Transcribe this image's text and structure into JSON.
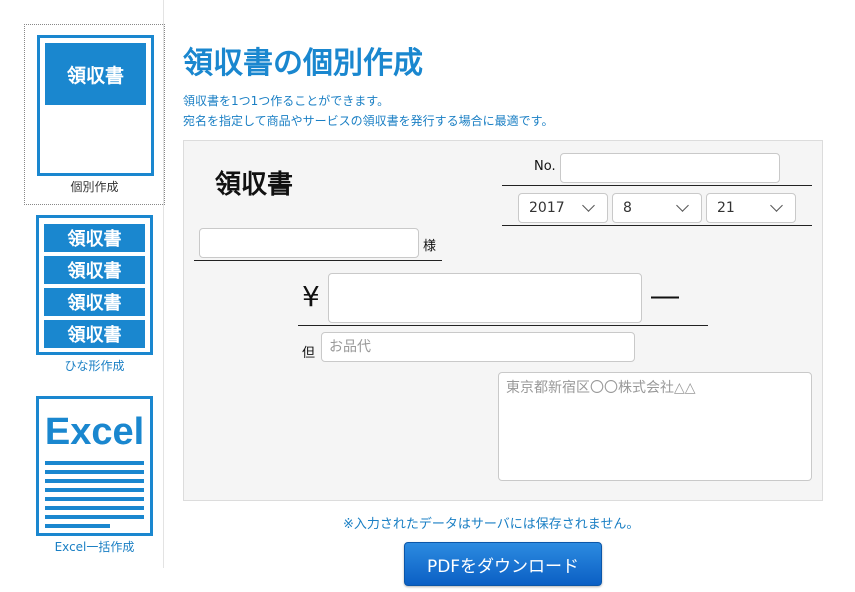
{
  "sidebar": {
    "items": [
      {
        "icon_text": "領収書",
        "label": "個別作成"
      },
      {
        "icon_rows": [
          "領収書",
          "領収書",
          "領収書",
          "領収書"
        ],
        "label": "ひな形作成"
      },
      {
        "icon_text": "Excel",
        "label": "Excel一括作成"
      }
    ]
  },
  "main": {
    "title": "領収書の個別作成",
    "description": [
      "領収書を1つ1つ作ることができます。",
      "宛名を指定して商品やサービスの領収書を発行する場合に最適です。"
    ]
  },
  "form": {
    "receipt_title": "領収書",
    "no_label": "No.",
    "no_value": "",
    "date": {
      "year": "2017",
      "month": "8",
      "day": "21"
    },
    "recipient_value": "",
    "sama_label": "様",
    "yen_symbol": "¥",
    "amount_value": "",
    "dash_symbol": "―",
    "tadashi_label": "但",
    "note_placeholder": "お品代",
    "issuer_placeholder": "東京都新宿区〇〇株式会社△△"
  },
  "footer": {
    "notice": "※入力されたデータはサーバには保存されません。",
    "pdf_button_label": "PDFをダウンロード"
  },
  "colors": {
    "accent": "#1a87cf",
    "link_text": "#1a7fc4",
    "panel_bg": "#f5f5f5",
    "button_blue": "#0b5fc4"
  }
}
